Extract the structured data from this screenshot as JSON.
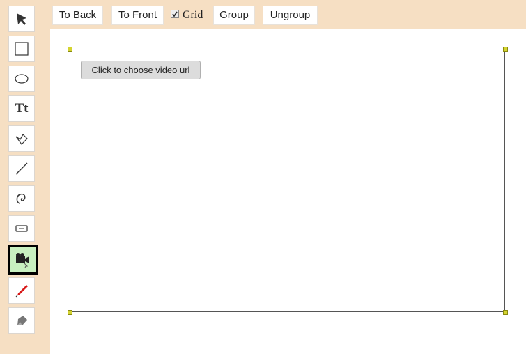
{
  "toolbar": {
    "to_back_label": "To Back",
    "to_front_label": "To Front",
    "grid_label": "Grid",
    "grid_checked": true,
    "group_label": "Group",
    "ungroup_label": "Ungroup"
  },
  "tools": [
    {
      "name": "select-arrow-icon"
    },
    {
      "name": "rectangle-icon"
    },
    {
      "name": "ellipse-icon"
    },
    {
      "name": "text-icon",
      "glyph": "Tt"
    },
    {
      "name": "polygon-icon"
    },
    {
      "name": "line-icon"
    },
    {
      "name": "freehand-icon"
    },
    {
      "name": "button-widget-icon"
    },
    {
      "name": "video-camera-icon",
      "active": true
    },
    {
      "name": "pen-icon"
    },
    {
      "name": "eraser-icon"
    }
  ],
  "canvas": {
    "video_button_label": "Click to choose video url"
  },
  "colors": {
    "panel_bg": "#f6dfc3",
    "active_tool_bg": "#c8f0c0",
    "handle": "#d4d430"
  }
}
